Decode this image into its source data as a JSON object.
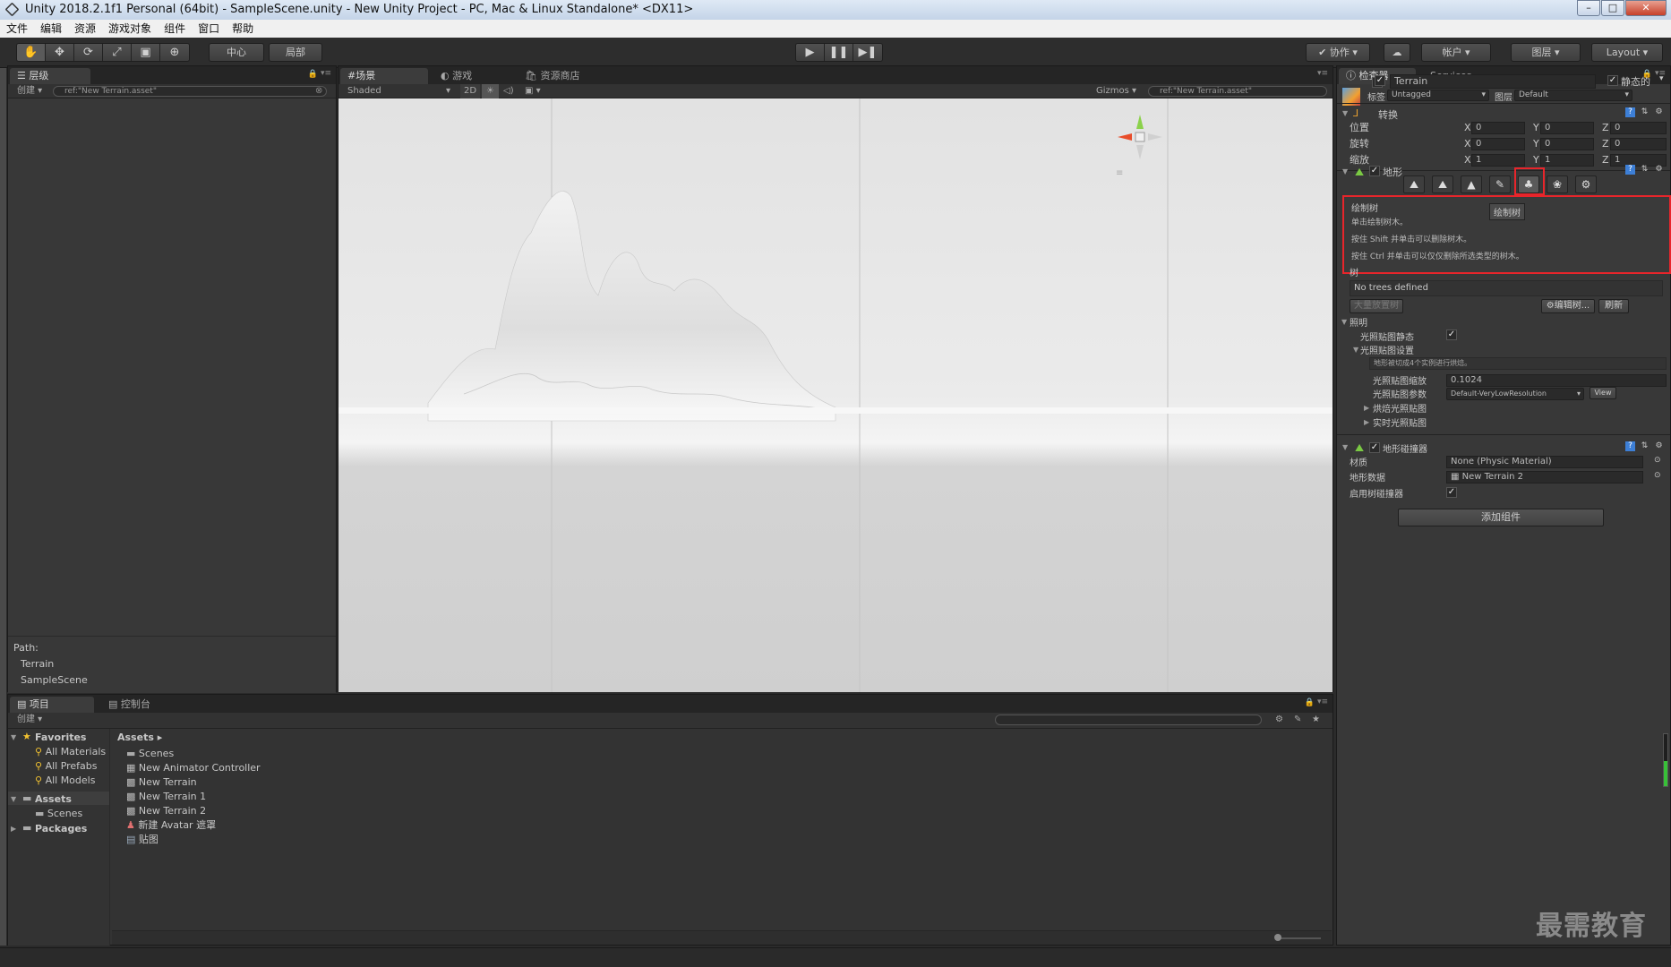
{
  "window": {
    "title": "Unity 2018.2.1f1 Personal (64bit) - SampleScene.unity - New Unity Project - PC, Mac & Linux Standalone* <DX11>"
  },
  "menu": [
    "文件",
    "编辑",
    "资源",
    "游戏对象",
    "组件",
    "窗口",
    "帮助"
  ],
  "toolbar": {
    "pivot": "中心",
    "space": "局部",
    "collab": "协作",
    "account": "帐户",
    "layers": "图层",
    "layout": "Layout"
  },
  "hierarchy": {
    "tab": "层级",
    "create": "创建",
    "search": "ref:\"New Terrain.asset\"",
    "path_label": "Path:",
    "path": [
      "Terrain",
      "SampleScene"
    ]
  },
  "scene": {
    "tabs": [
      "场景",
      "游戏",
      "资源商店"
    ],
    "shading": "Shaded",
    "mode_2d": "2D",
    "gizmos": "Gizmos",
    "search": "ref:\"New Terrain.asset\""
  },
  "inspector": {
    "tabs": [
      "检查器",
      "Services"
    ],
    "object_name": "Terrain",
    "static_label": "静态的",
    "tag_label": "标签",
    "tag": "Untagged",
    "layer_label": "图层",
    "layer": "Default",
    "transform": {
      "title": "转换",
      "rows": [
        {
          "label": "位置",
          "x": "0",
          "y": "0",
          "z": "0"
        },
        {
          "label": "旋转",
          "x": "0",
          "y": "0",
          "z": "0"
        },
        {
          "label": "缩放",
          "x": "1",
          "y": "1",
          "z": "1"
        }
      ],
      "axis_x": "X",
      "axis_y": "Y",
      "axis_z": "Z"
    },
    "terrain": {
      "title": "地形",
      "tool_tip": "绘制树",
      "info_title": "绘制树",
      "info_lines": [
        "单击绘制树木。",
        "按住 Shift 并单击可以删除树木。",
        "按住 Ctrl 并单击可以仅仅删除所选类型的树木。"
      ],
      "trees_label": "树",
      "no_trees": "No trees defined",
      "mass_place": "大量放置树",
      "edit_trees": "编辑树...",
      "refresh": "刷新",
      "lighting": "照明",
      "lightmap_static": "光照贴图静态",
      "lightmap_settings": "光照贴图设置",
      "lightmap_note": "地形被切成4个实例进行烘焙。",
      "lightmap_scale_label": "光照贴图缩放",
      "lightmap_scale": "0.1024",
      "lightmap_params_label": "光照贴图参数",
      "lightmap_params": "Default-VeryLowResolution",
      "view": "View",
      "baked_lightmap": "烘焙光照贴图",
      "realtime_lightmap": "实时光照贴图"
    },
    "collider": {
      "title": "地形碰撞器",
      "material_label": "材质",
      "material": "None (Physic Material)",
      "data_label": "地形数据",
      "data": "New Terrain 2",
      "trees_label": "启用树碰撞器"
    },
    "add_component": "添加组件"
  },
  "project": {
    "tabs": [
      "项目",
      "控制台"
    ],
    "create": "创建",
    "favorites_label": "Favorites",
    "favorites": [
      "All Materials",
      "All Prefabs",
      "All Models"
    ],
    "assets_label": "Assets",
    "assets_children": [
      "Scenes"
    ],
    "packages_label": "Packages",
    "breadcrumb": "Assets",
    "items": [
      "Scenes",
      "New Animator Controller",
      "New Terrain",
      "New Terrain 1",
      "New Terrain 2",
      "新建 Avatar 遮罩",
      "贴图"
    ]
  },
  "watermark": "最需教育",
  "colors": {
    "highlight": "#e8252b",
    "accent": "#3d7fd6"
  }
}
